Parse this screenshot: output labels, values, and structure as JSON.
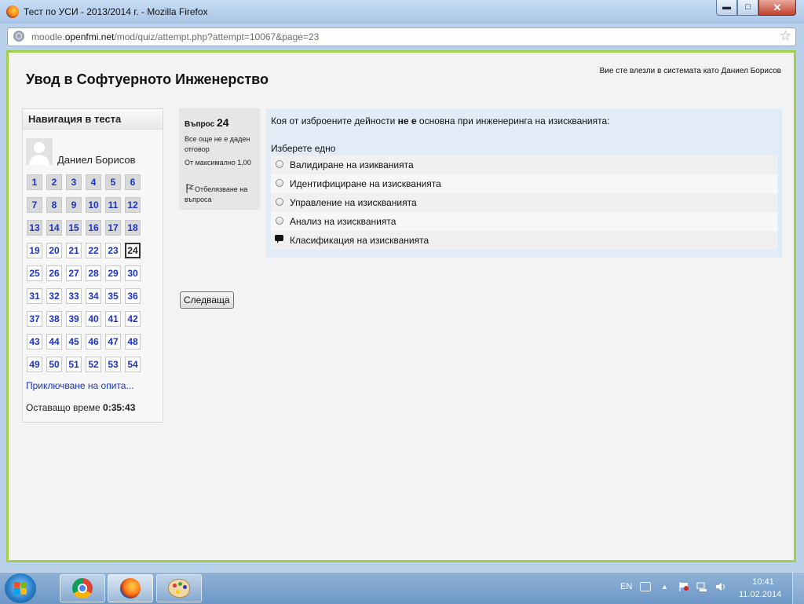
{
  "window": {
    "title": "Тест по УСИ - 2013/2014 г. - Mozilla Firefox",
    "url_prefix": "moodle.",
    "url_domain": "openfmi.net",
    "url_path": "/mod/quiz/attempt.php?attempt=10067&page=23"
  },
  "header": {
    "course_title": "Увод в Софтуерното Инженерство",
    "login_info": "Вие сте влезли в системата като Даниел Борисов"
  },
  "navigation": {
    "title": "Навигация в теста",
    "user_name": "Даниел Борисов",
    "questions": [
      {
        "label": "1",
        "state": "answered"
      },
      {
        "label": "2",
        "state": "answered"
      },
      {
        "label": "3",
        "state": "answered"
      },
      {
        "label": "4",
        "state": "answered"
      },
      {
        "label": "5",
        "state": "answered"
      },
      {
        "label": "6",
        "state": "answered"
      },
      {
        "label": "7",
        "state": "answered"
      },
      {
        "label": "8",
        "state": "answered"
      },
      {
        "label": "9",
        "state": "answered"
      },
      {
        "label": "10",
        "state": "answered"
      },
      {
        "label": "11",
        "state": "answered"
      },
      {
        "label": "12",
        "state": "answered"
      },
      {
        "label": "13",
        "state": "answered"
      },
      {
        "label": "14",
        "state": "answered"
      },
      {
        "label": "15",
        "state": "answered"
      },
      {
        "label": "16",
        "state": "answered"
      },
      {
        "label": "17",
        "state": "answered"
      },
      {
        "label": "18",
        "state": "answered"
      },
      {
        "label": "19",
        "state": "unanswered"
      },
      {
        "label": "20",
        "state": "unanswered"
      },
      {
        "label": "21",
        "state": "unanswered"
      },
      {
        "label": "22",
        "state": "unanswered"
      },
      {
        "label": "23",
        "state": "unanswered"
      },
      {
        "label": "24",
        "state": "current"
      },
      {
        "label": "25",
        "state": "unanswered"
      },
      {
        "label": "26",
        "state": "unanswered"
      },
      {
        "label": "27",
        "state": "unanswered"
      },
      {
        "label": "28",
        "state": "unanswered"
      },
      {
        "label": "29",
        "state": "unanswered"
      },
      {
        "label": "30",
        "state": "unanswered"
      },
      {
        "label": "31",
        "state": "unanswered"
      },
      {
        "label": "32",
        "state": "unanswered"
      },
      {
        "label": "33",
        "state": "unanswered"
      },
      {
        "label": "34",
        "state": "unanswered"
      },
      {
        "label": "35",
        "state": "unanswered"
      },
      {
        "label": "36",
        "state": "unanswered"
      },
      {
        "label": "37",
        "state": "unanswered"
      },
      {
        "label": "38",
        "state": "unanswered"
      },
      {
        "label": "39",
        "state": "unanswered"
      },
      {
        "label": "40",
        "state": "unanswered"
      },
      {
        "label": "41",
        "state": "unanswered"
      },
      {
        "label": "42",
        "state": "unanswered"
      },
      {
        "label": "43",
        "state": "unanswered"
      },
      {
        "label": "44",
        "state": "unanswered"
      },
      {
        "label": "45",
        "state": "unanswered"
      },
      {
        "label": "46",
        "state": "unanswered"
      },
      {
        "label": "47",
        "state": "unanswered"
      },
      {
        "label": "48",
        "state": "unanswered"
      },
      {
        "label": "49",
        "state": "unanswered"
      },
      {
        "label": "50",
        "state": "unanswered"
      },
      {
        "label": "51",
        "state": "unanswered"
      },
      {
        "label": "52",
        "state": "unanswered"
      },
      {
        "label": "53",
        "state": "unanswered"
      },
      {
        "label": "54",
        "state": "unanswered"
      }
    ],
    "finish_link": "Приключване на опита...",
    "timer_label": "Оставащо време",
    "timer_value": "0:35:43"
  },
  "question": {
    "number_label": "Въпрос",
    "number": "24",
    "state": "Все още не е даден отговор",
    "grade": "От максимално 1,00",
    "flag_label": "Отбелязване на въпроса",
    "text_before": "Коя от изброените дейности",
    "text_bold": "не е",
    "text_after": "основна при инженеринга на изискванията:",
    "prompt": "Изберете едно",
    "answers": [
      "Валидиране на изикванията",
      "Идентифициране на изискванията",
      "Управление на изискванията",
      "Анализ на изискванията",
      "Класификация на изискванията"
    ]
  },
  "next_button": "Следваща",
  "taskbar": {
    "language": "EN",
    "time": "10:41",
    "date": "11.02.2014"
  },
  "colors": {
    "link": "#1a33c8",
    "frame_border": "#a3d04a",
    "question_bg": "#e2ecf6"
  }
}
